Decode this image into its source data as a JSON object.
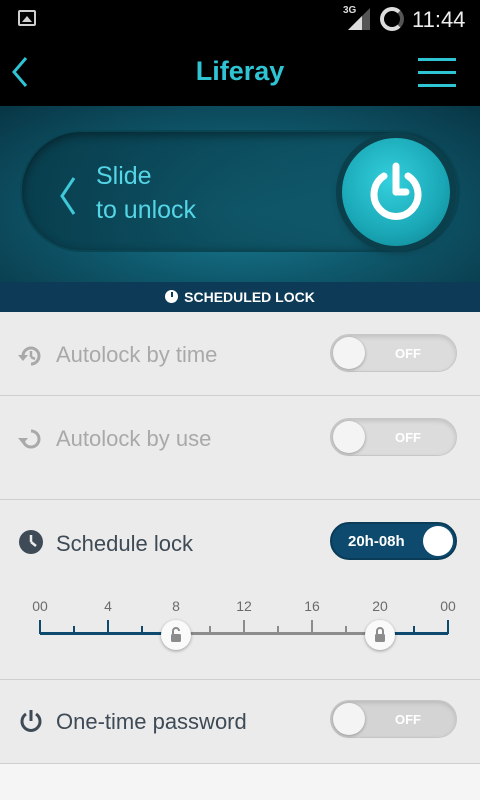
{
  "status_bar": {
    "network": "3G",
    "time": "11:44"
  },
  "app_bar": {
    "title": "Liferay",
    "back_icon": "chevron-left-icon",
    "menu_icon": "hamburger-menu-icon"
  },
  "unlock_slider": {
    "line1": "Slide",
    "line2": "to unlock",
    "knob_icon": "power-icon"
  },
  "section_header": {
    "label": "SCHEDULED LOCK",
    "icon": "clock-icon"
  },
  "settings": [
    {
      "label": "Autolock by time",
      "icon": "history-icon",
      "toggle": "OFF",
      "enabled": false
    },
    {
      "label": "Autolock by use",
      "icon": "refresh-icon",
      "toggle": "OFF",
      "enabled": false
    },
    {
      "label": "Schedule lock",
      "icon": "clock-icon",
      "toggle": "20h-08h",
      "enabled": true
    },
    {
      "label": "One-time password",
      "icon": "power-icon",
      "toggle": "OFF",
      "enabled": true
    }
  ],
  "schedule_timeline": {
    "tick_labels": [
      "00",
      "4",
      "8",
      "12",
      "16",
      "20",
      "00"
    ],
    "unlock_hour": 8,
    "lock_hour": 20
  },
  "colors": {
    "accent": "#2fc4d4",
    "dark_blue": "#0d4a6e",
    "header_bar": "#0d3a57"
  }
}
